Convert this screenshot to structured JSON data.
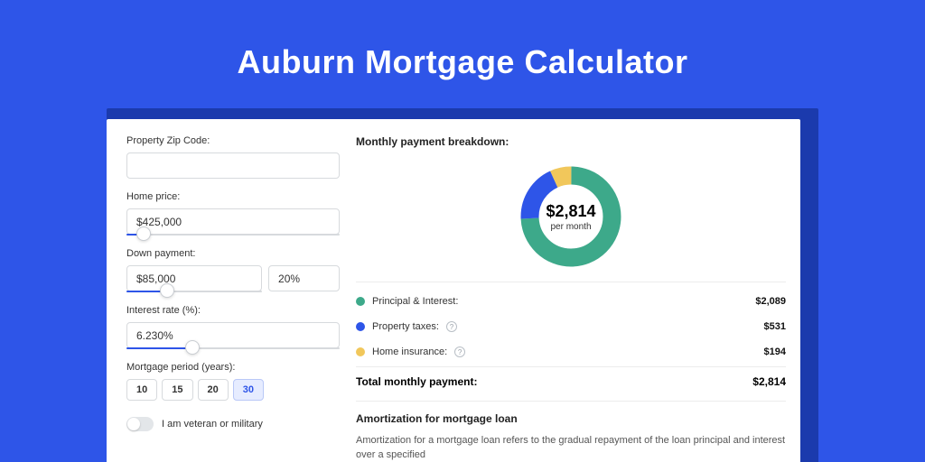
{
  "page": {
    "title": "Auburn Mortgage Calculator"
  },
  "form": {
    "zip_label": "Property Zip Code:",
    "zip_value": "",
    "home_price_label": "Home price:",
    "home_price_value": "$425,000",
    "home_price_fill_pct": 8,
    "down_payment_label": "Down payment:",
    "down_payment_value": "$85,000",
    "down_payment_pct_value": "20%",
    "down_payment_fill_pct": 30,
    "interest_label": "Interest rate (%):",
    "interest_value": "6.230%",
    "interest_fill_pct": 31,
    "period_label": "Mortgage period (years):",
    "periods": [
      "10",
      "15",
      "20",
      "30"
    ],
    "period_selected_index": 3,
    "veteran_label": "I am veteran or military",
    "veteran_on": false
  },
  "breakdown": {
    "title": "Monthly payment breakdown:",
    "center_amount": "$2,814",
    "center_sub": "per month",
    "rows": [
      {
        "label": "Principal & Interest:",
        "value": "$2,089",
        "color": "green",
        "help": false
      },
      {
        "label": "Property taxes:",
        "value": "$531",
        "color": "blue",
        "help": true
      },
      {
        "label": "Home insurance:",
        "value": "$194",
        "color": "yellow",
        "help": true
      }
    ],
    "total_label": "Total monthly payment:",
    "total_value": "$2,814"
  },
  "chart_data": {
    "type": "pie",
    "title": "Monthly payment breakdown:",
    "categories": [
      "Principal & Interest",
      "Property taxes",
      "Home insurance"
    ],
    "values": [
      2089,
      531,
      194
    ],
    "colors": [
      "#3da98a",
      "#2e55e8",
      "#f1c75b"
    ],
    "total": 2814,
    "center_label": "$2,814 per month"
  },
  "amort": {
    "title": "Amortization for mortgage loan",
    "text": "Amortization for a mortgage loan refers to the gradual repayment of the loan principal and interest over a specified"
  }
}
